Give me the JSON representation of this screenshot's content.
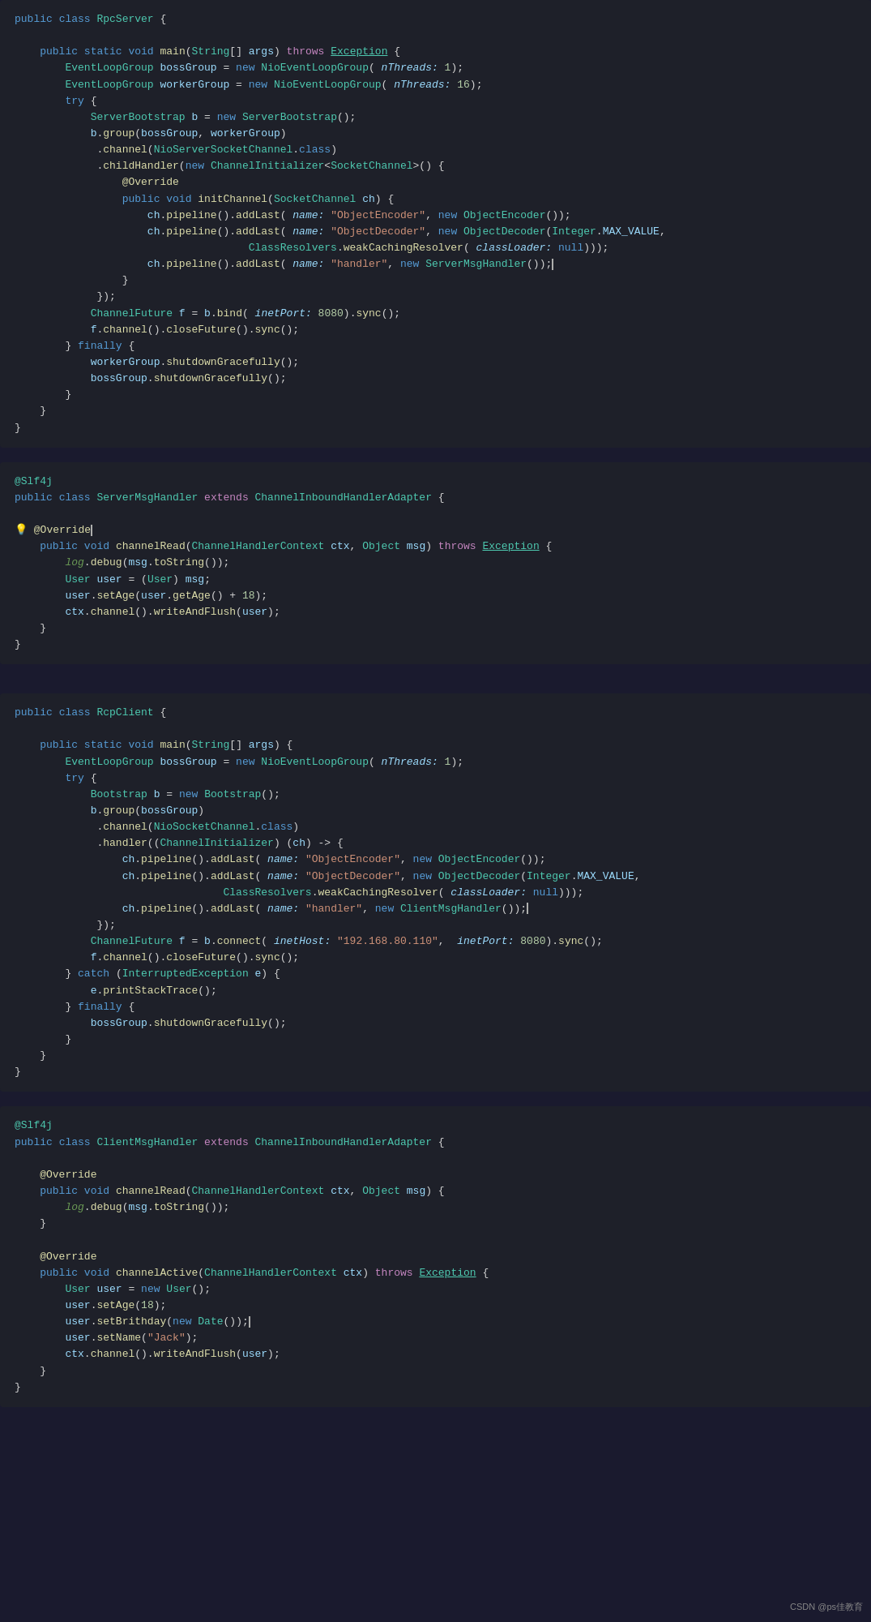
{
  "blocks": [
    {
      "id": "rpc-server",
      "label": "RpcServer code block"
    },
    {
      "id": "server-msg-handler",
      "label": "ServerMsgHandler code block"
    },
    {
      "id": "rpc-client",
      "label": "RpcClient code block"
    },
    {
      "id": "client-msg-handler",
      "label": "ClientMsgHandler code block"
    }
  ],
  "watermark": "CSDN @ps佳教育"
}
